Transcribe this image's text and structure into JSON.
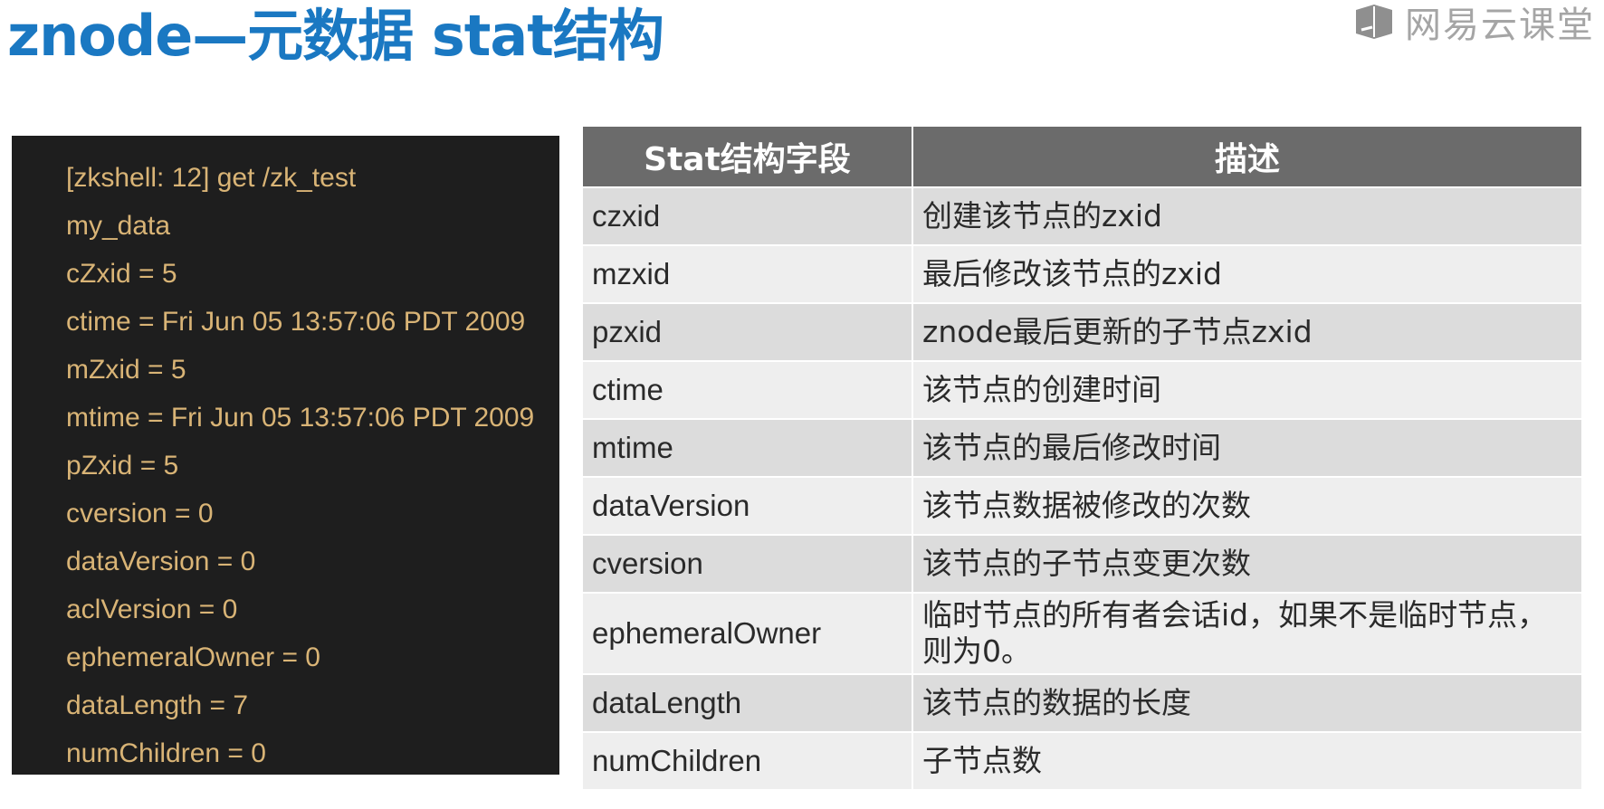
{
  "title": "znode—元数据 stat结构",
  "brand": {
    "name": "网易云课堂",
    "logo_icon": "book-icon"
  },
  "terminal": {
    "lines": [
      "[zkshell: 12] get /zk_test",
      "my_data",
      "cZxid = 5",
      "ctime = Fri Jun 05 13:57:06 PDT 2009",
      "mZxid = 5",
      "mtime = Fri Jun 05 13:57:06 PDT 2009",
      "pZxid = 5",
      "cversion = 0",
      "dataVersion = 0",
      "aclVersion = 0",
      "ephemeralOwner = 0",
      "dataLength = 7",
      "numChildren = 0"
    ]
  },
  "table": {
    "headers": [
      "Stat结构字段",
      "描述"
    ],
    "rows": [
      {
        "field": "czxid",
        "desc": "创建该节点的zxid"
      },
      {
        "field": "mzxid",
        "desc": "最后修改该节点的zxid"
      },
      {
        "field": "pzxid",
        "desc": "znode最后更新的子节点zxid"
      },
      {
        "field": "ctime",
        "desc": "该节点的创建时间"
      },
      {
        "field": "mtime",
        "desc": "该节点的最后修改时间"
      },
      {
        "field": "dataVersion",
        "desc": "该节点数据被修改的次数"
      },
      {
        "field": "cversion",
        "desc": "该节点的子节点变更次数"
      },
      {
        "field": "ephemeralOwner",
        "desc": "临时节点的所有者会话id，如果不是临时节点，则为0。"
      },
      {
        "field": "dataLength",
        "desc": "该节点的数据的长度"
      },
      {
        "field": "numChildren",
        "desc": "子节点数"
      }
    ]
  },
  "colors": {
    "title": "#1a78c2",
    "terminal_bg": "#1e1e1e",
    "terminal_text": "#d9b476",
    "table_header_bg": "#6b6b6b",
    "row_odd": "#dcdcdc",
    "row_even": "#eeeeee"
  }
}
